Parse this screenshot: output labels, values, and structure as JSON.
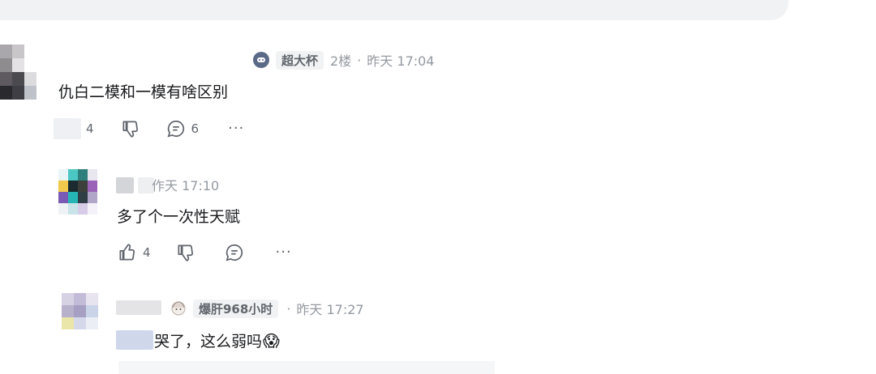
{
  "comments": [
    {
      "floor": "2楼",
      "time": "昨天 17:04",
      "fan_badge": "超大杯",
      "text": "仇白二模和一模有啥区别",
      "likes": "4",
      "replies": "6",
      "medal_icon": "gamepad-medal-icon"
    },
    {
      "time_partial": "作天 17:10",
      "text": "多了个一次性天赋",
      "likes": "4"
    },
    {
      "fan_badge": "爆肝968小时",
      "time": "昨天 17:27",
      "text": "哭了，这么弱吗",
      "emoji": "😱",
      "fan_icon": "anime-girl-medal-icon"
    }
  ],
  "icons": {
    "like": "thumb-up-icon",
    "dislike": "thumb-down-icon",
    "reply": "reply-bubble-icon",
    "more": "more-dots-icon"
  }
}
